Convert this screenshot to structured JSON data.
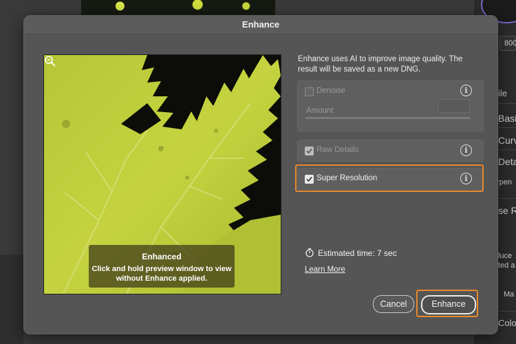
{
  "dialog": {
    "title": "Enhance",
    "description": "Enhance uses AI to improve image quality. The result will be saved as a new DNG.",
    "preview": {
      "overlay_title": "Enhanced",
      "overlay_text_line1": "Click and hold preview window to view",
      "overlay_text_line2": "without Enhance applied."
    },
    "options": {
      "denoise": {
        "label": "Denoise",
        "checked": false
      },
      "amount_label": "Amount",
      "raw_details": {
        "label": "Raw Details",
        "checked": true
      },
      "super_resolution": {
        "label": "Super Resolution",
        "checked": true
      }
    },
    "estimated_time": "Estimated time: 7 sec",
    "learn_more": "Learn More",
    "buttons": {
      "cancel": "Cancel",
      "enhance": "Enhance"
    }
  },
  "background_panel": {
    "items": [
      "800",
      "ile",
      "Basi",
      "Curv",
      "Deta",
      "rpen",
      "se R",
      "luce",
      "ted a",
      "Ma",
      "Colo"
    ]
  },
  "colors": {
    "highlight": "#e8892f",
    "dialog_bg": "#555555",
    "leaf": "#bccb3a"
  }
}
